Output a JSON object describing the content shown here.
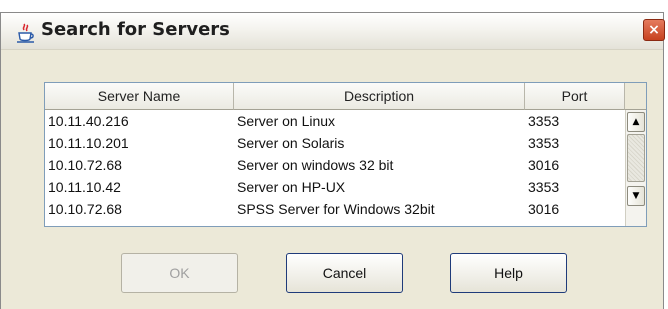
{
  "window": {
    "title": "Search for Servers",
    "title_icon": "java-coffee-cup-icon",
    "close_icon": "close-icon",
    "close_glyph": "×"
  },
  "table": {
    "columns": [
      "Server Name",
      "Description",
      "Port"
    ],
    "rows": [
      {
        "name": "10.11.40.216",
        "description": "Server on Linux",
        "port": "3353"
      },
      {
        "name": "10.11.10.201",
        "description": "Server on Solaris",
        "port": "3353"
      },
      {
        "name": "10.10.72.68",
        "description": "Server on windows 32 bit",
        "port": "3016"
      },
      {
        "name": "10.11.10.42",
        "description": "Server on HP-UX",
        "port": "3353"
      },
      {
        "name": "10.10.72.68",
        "description": "SPSS Server for Windows 32bit",
        "port": "3016"
      }
    ]
  },
  "scrollbar": {
    "up_glyph": "▲",
    "down_glyph": "▼"
  },
  "buttons": {
    "ok": "OK",
    "cancel": "Cancel",
    "help": "Help"
  },
  "colors": {
    "dialog_background": "#ece9d8",
    "close_button": "#c7421f",
    "table_border": "#7f9db9"
  }
}
